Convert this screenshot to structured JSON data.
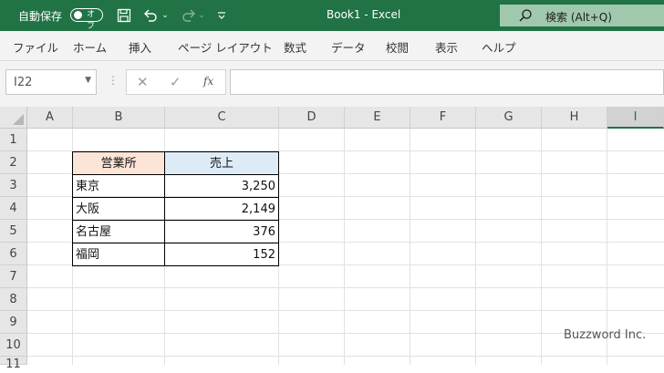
{
  "titlebar": {
    "autosave_label": "自動保存",
    "autosave_state": "オフ",
    "title": "Book1  -  Excel",
    "search_placeholder": "検索 (Alt+Q)",
    "save_icon": "save-icon",
    "undo_icon": "undo-icon",
    "redo_icon": "redo-icon",
    "customize_icon": "customize-quick-access-icon"
  },
  "ribbon": {
    "tabs": [
      "ファイル",
      "ホーム",
      "挿入",
      "ページ レイアウト",
      "数式",
      "データ",
      "校閲",
      "表示",
      "ヘルプ"
    ]
  },
  "formula_bar": {
    "name_box": "I22",
    "fx": "fx",
    "formula": ""
  },
  "sheet": {
    "columns": [
      "A",
      "B",
      "C",
      "D",
      "E",
      "F",
      "G",
      "H",
      "I"
    ],
    "selected_column": "I",
    "rows": [
      "1",
      "2",
      "3",
      "4",
      "5",
      "6",
      "7",
      "8",
      "9",
      "10",
      "11"
    ],
    "table": {
      "header_office": "営業所",
      "header_sales": "売上",
      "rows": [
        {
          "office": "東京",
          "sales": "3,250"
        },
        {
          "office": "大阪",
          "sales": "2,149"
        },
        {
          "office": "名古屋",
          "sales": "376"
        },
        {
          "office": "福岡",
          "sales": "152"
        }
      ]
    }
  },
  "watermark": "Buzzword Inc."
}
